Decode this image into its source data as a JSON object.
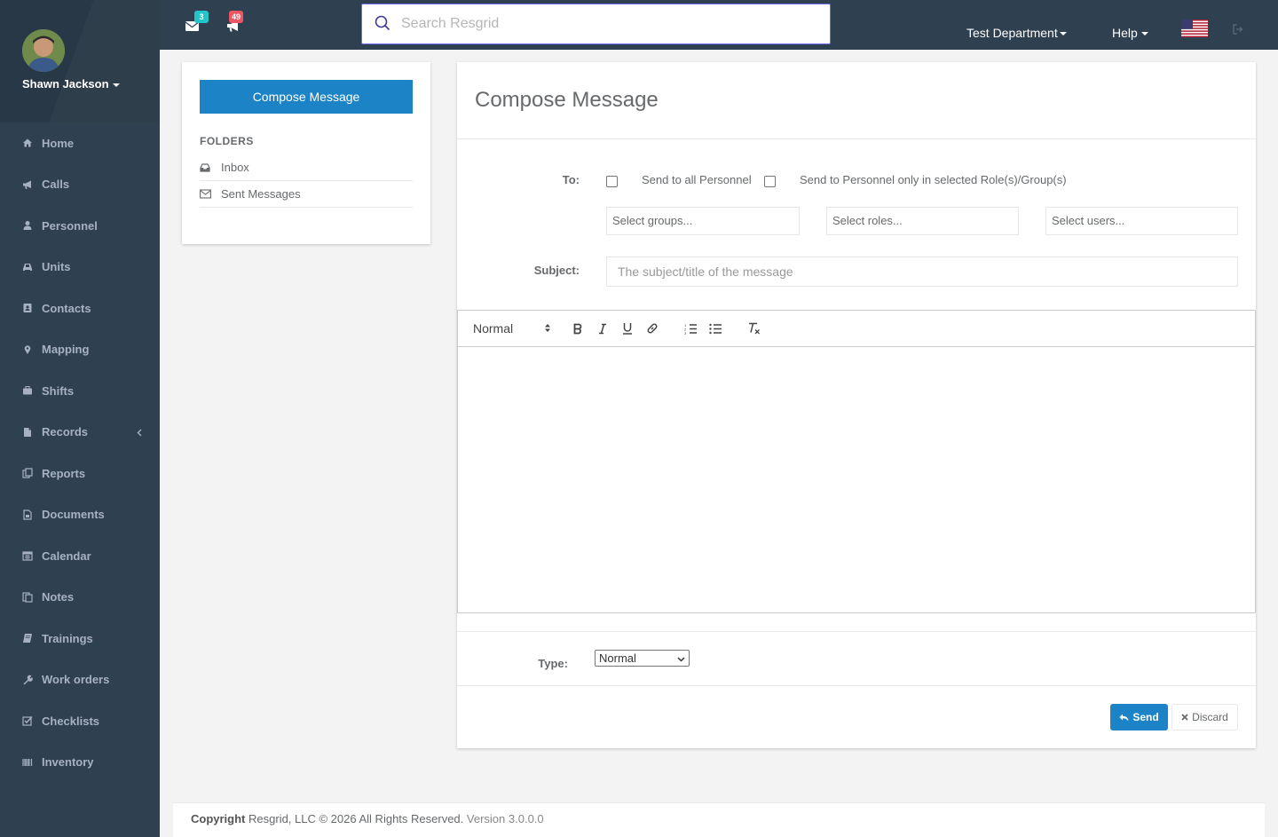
{
  "user": {
    "name": "Shawn Jackson"
  },
  "sidebar": {
    "items": [
      {
        "label": "Home",
        "icon": "home-icon"
      },
      {
        "label": "Calls",
        "icon": "bullhorn-icon"
      },
      {
        "label": "Personnel",
        "icon": "user-icon"
      },
      {
        "label": "Units",
        "icon": "truck-icon"
      },
      {
        "label": "Contacts",
        "icon": "contact-icon"
      },
      {
        "label": "Mapping",
        "icon": "map-marker-icon"
      },
      {
        "label": "Shifts",
        "icon": "briefcase-icon"
      },
      {
        "label": "Records",
        "icon": "file-icon",
        "has_submenu": true
      },
      {
        "label": "Reports",
        "icon": "reports-icon"
      },
      {
        "label": "Documents",
        "icon": "document-icon"
      },
      {
        "label": "Calendar",
        "icon": "calendar-icon"
      },
      {
        "label": "Notes",
        "icon": "notes-icon"
      },
      {
        "label": "Trainings",
        "icon": "book-icon"
      },
      {
        "label": "Work orders",
        "icon": "wrench-icon"
      },
      {
        "label": "Checklists",
        "icon": "checklist-icon"
      },
      {
        "label": "Inventory",
        "icon": "barcode-icon"
      }
    ]
  },
  "topbar": {
    "messages_count": "3",
    "calls_count": "49",
    "search_placeholder": "Search Resgrid",
    "department": "Test Department",
    "help": "Help",
    "badge_colors": {
      "messages": "#23c6c8",
      "calls": "#ed5565"
    }
  },
  "folders": {
    "compose_label": "Compose Message",
    "heading": "FOLDERS",
    "items": [
      {
        "label": "Inbox",
        "icon": "inbox-icon"
      },
      {
        "label": "Sent Messages",
        "icon": "envelope-icon"
      }
    ]
  },
  "compose": {
    "title": "Compose Message",
    "to_label": "To:",
    "send_all_label": "Send to all Personnel",
    "send_selected_label": "Send to Personnel only in selected Role(s)/Group(s)",
    "groups_placeholder": "Select groups...",
    "roles_placeholder": "Select roles...",
    "users_placeholder": "Select users...",
    "subject_label": "Subject:",
    "subject_placeholder": "The subject/title of the message",
    "editor_format": "Normal",
    "type_label": "Type:",
    "type_value": "Normal",
    "send_label": "Send",
    "discard_label": "Discard"
  },
  "footer": {
    "copyright_bold": "Copyright",
    "copyright_text": "Resgrid, LLC © 2026 All Rights Reserved.",
    "version": "Version 3.0.0.0"
  },
  "colors": {
    "sidebar": "#2f4050",
    "primary": "#1c84c6"
  }
}
